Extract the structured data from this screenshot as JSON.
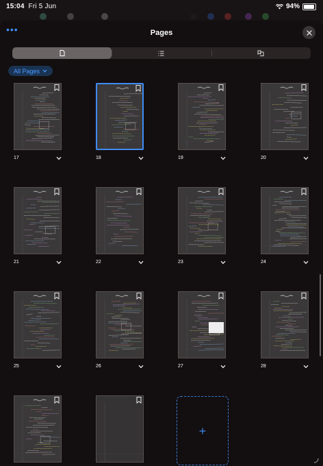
{
  "status_bar": {
    "time": "15:04",
    "date": "Fri 5 Jun",
    "battery_text": "94%",
    "battery_level": 0.94
  },
  "sheet": {
    "title": "Pages",
    "more_glyph": "•••",
    "close_icon": "close-icon"
  },
  "segments": [
    {
      "icon": "page-thumbnail-icon",
      "active": true
    },
    {
      "icon": "outline-list-icon",
      "active": false
    },
    {
      "icon": "bookmark-filter-icon",
      "active": false
    }
  ],
  "filter": {
    "label": "All Pages",
    "icon": "chevron-down-icon"
  },
  "colors": {
    "accent": "#3f8cf5",
    "background": "#130e0f",
    "thumbnail": "#3a3839"
  },
  "pages": [
    {
      "number": "17",
      "selected": false
    },
    {
      "number": "18",
      "selected": true
    },
    {
      "number": "19",
      "selected": false
    },
    {
      "number": "20",
      "selected": false
    },
    {
      "number": "21",
      "selected": false
    },
    {
      "number": "22",
      "selected": false
    },
    {
      "number": "23",
      "selected": false
    },
    {
      "number": "24",
      "selected": false
    },
    {
      "number": "25",
      "selected": false
    },
    {
      "number": "26",
      "selected": false
    },
    {
      "number": "27",
      "selected": false
    },
    {
      "number": "28",
      "selected": false
    },
    {
      "number": "",
      "selected": false
    },
    {
      "number": "",
      "selected": false
    }
  ],
  "add_page": {
    "icon": "plus-icon",
    "label": "+"
  }
}
